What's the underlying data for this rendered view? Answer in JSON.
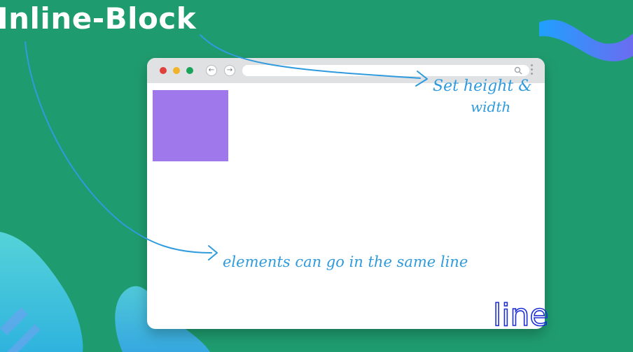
{
  "title": "Inline-Block",
  "annotations": {
    "top_note_line1": "Set height &",
    "top_note_line2": "width",
    "bottom_note": "elements can go in the same line",
    "handwritten": "line"
  },
  "colors": {
    "background": "#1f9c6f",
    "box": "#9f78ec",
    "annotation": "#2f9bde",
    "ink": "#1d2fd6"
  },
  "icons": [
    "back-arrow-icon",
    "forward-arrow-icon",
    "search-icon",
    "kebab-menu-icon"
  ]
}
